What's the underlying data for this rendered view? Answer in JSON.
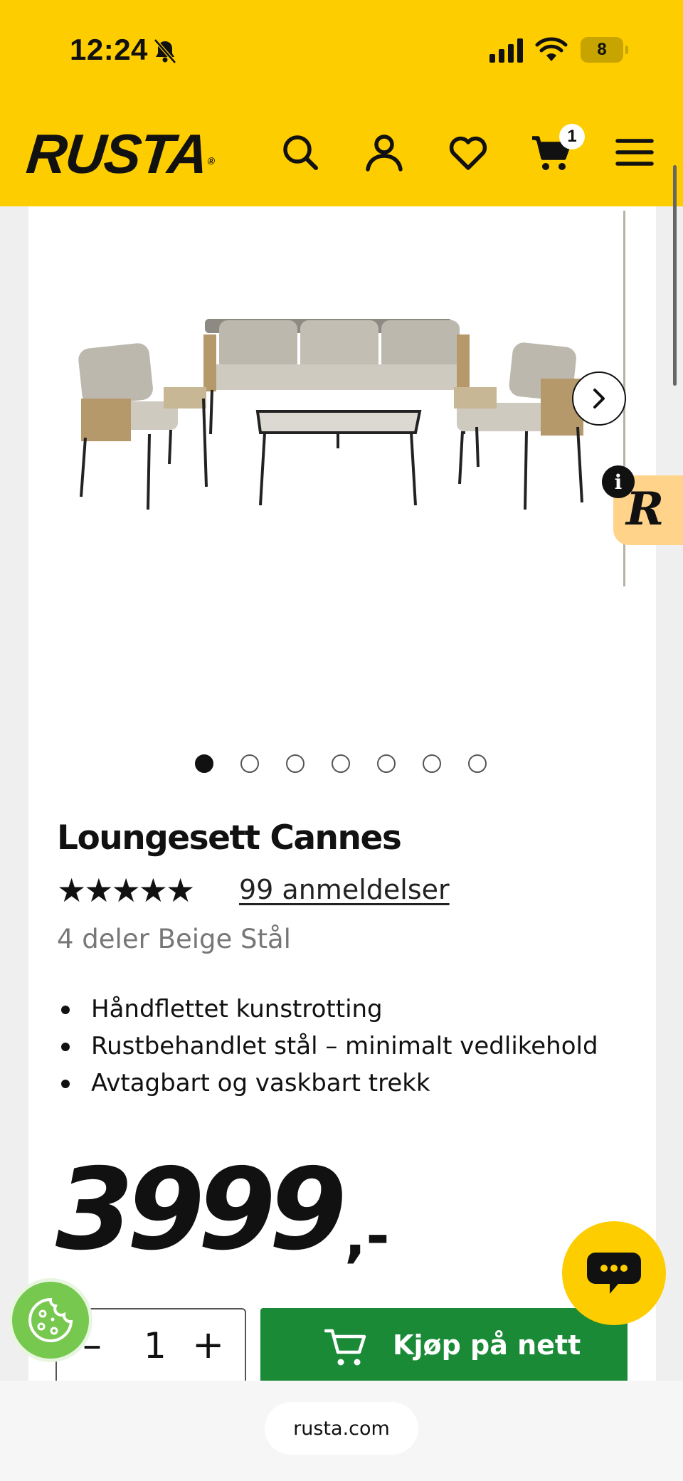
{
  "status_bar": {
    "time": "12:24",
    "battery": "8"
  },
  "header": {
    "logo": "RUSTA",
    "logo_mark": "®",
    "cart_count": "1",
    "icons": [
      "search-icon",
      "account-icon",
      "heart-icon",
      "cart-icon",
      "menu-icon"
    ]
  },
  "gallery": {
    "total_images": 7,
    "active_index": 0
  },
  "product": {
    "title": "Loungesett Cannes",
    "stars": "★★★★★",
    "rating": 5,
    "reviews": "99 anmeldelser",
    "variant": "4 deler Beige Stål",
    "features": [
      "Håndflettet kunstrotting",
      "Rustbehandlet stål – minimalt vedlikehold",
      "Avtagbart og vaskbart trekk"
    ],
    "price": "3999",
    "price_suffix": ",-"
  },
  "purchase": {
    "minus": "–",
    "quantity": "1",
    "plus": "+",
    "buy_label": "Kjøp på nett"
  },
  "browser": {
    "url": "rusta.com"
  },
  "colors": {
    "brand_yellow": "#fdcd00",
    "buy_green": "#1a8a37",
    "cookie_green": "#77c84e"
  }
}
